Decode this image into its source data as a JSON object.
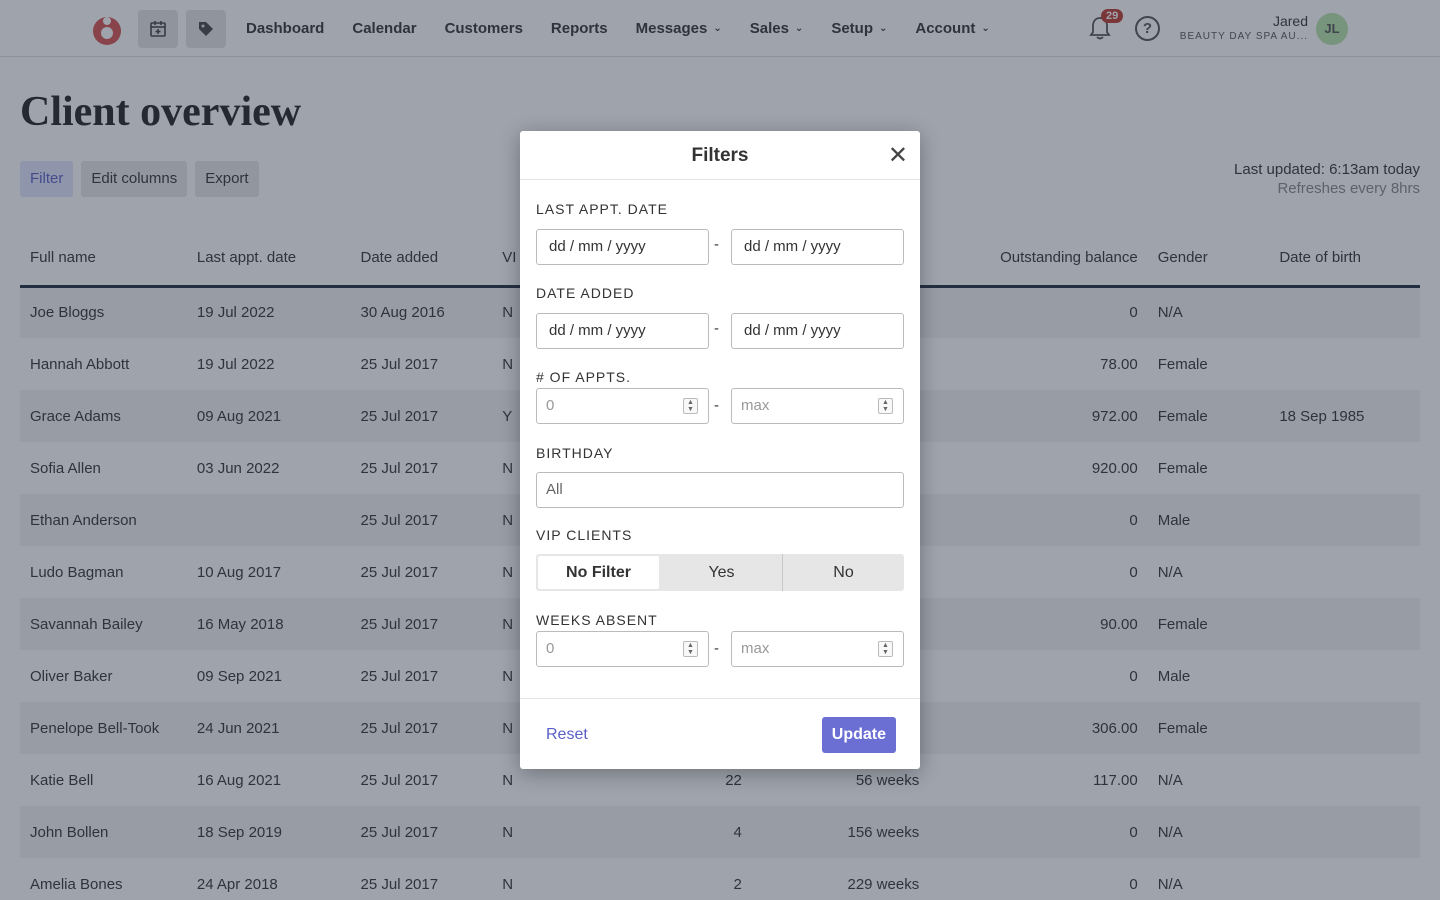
{
  "nav": {
    "links": [
      {
        "label": "Dashboard",
        "dropdown": false
      },
      {
        "label": "Calendar",
        "dropdown": false
      },
      {
        "label": "Customers",
        "dropdown": false
      },
      {
        "label": "Reports",
        "dropdown": false
      },
      {
        "label": "Messages",
        "dropdown": true
      },
      {
        "label": "Sales",
        "dropdown": true
      },
      {
        "label": "Setup",
        "dropdown": true
      },
      {
        "label": "Account",
        "dropdown": true
      }
    ],
    "notification_count": "29",
    "help_glyph": "?",
    "user_name": "Jared",
    "user_org": "BEAUTY DAY SPA AU...",
    "user_initials": "JL",
    "icons": [
      "calendar-plus-icon",
      "tag-icon",
      "bell-icon",
      "help-icon"
    ],
    "accent": "#d9534f"
  },
  "page": {
    "title": "Client overview",
    "toolbar": {
      "filter": "Filter",
      "edit_columns": "Edit columns",
      "export": "Export"
    },
    "last_updated": "Last updated: 6:13am today",
    "refreshes": "Refreshes every 8hrs"
  },
  "table": {
    "headers": {
      "full_name": "Full name",
      "last_appt": "Last appt. date",
      "date_added": "Date added",
      "vip": "VI",
      "balance": "Outstanding balance",
      "gender": "Gender",
      "dob": "Date of birth"
    },
    "rows": [
      {
        "name": "Joe Bloggs",
        "last": "19 Jul 2022",
        "added": "30 Aug 2016",
        "vip": "N",
        "appts": "",
        "absent": "",
        "balance": "0",
        "gender": "N/A",
        "dob": ""
      },
      {
        "name": "Hannah Abbott",
        "last": "19 Jul 2022",
        "added": "25 Jul 2017",
        "vip": "N",
        "appts": "",
        "absent": "",
        "balance": "78.00",
        "gender": "Female",
        "dob": ""
      },
      {
        "name": "Grace Adams",
        "last": "09 Aug 2021",
        "added": "25 Jul 2017",
        "vip": "Y",
        "appts": "",
        "absent": "",
        "balance": "972.00",
        "gender": "Female",
        "dob": "18 Sep 1985"
      },
      {
        "name": "Sofia Allen",
        "last": "03 Jun 2022",
        "added": "25 Jul 2017",
        "vip": "N",
        "appts": "",
        "absent": "",
        "balance": "920.00",
        "gender": "Female",
        "dob": ""
      },
      {
        "name": "Ethan Anderson",
        "last": "",
        "added": "25 Jul 2017",
        "vip": "N",
        "appts": "",
        "absent": "",
        "balance": "0",
        "gender": "Male",
        "dob": ""
      },
      {
        "name": "Ludo Bagman",
        "last": "10 Aug 2017",
        "added": "25 Jul 2017",
        "vip": "N",
        "appts": "",
        "absent": "",
        "balance": "0",
        "gender": "N/A",
        "dob": ""
      },
      {
        "name": "Savannah Bailey",
        "last": "16 May 2018",
        "added": "25 Jul 2017",
        "vip": "N",
        "appts": "",
        "absent": "",
        "balance": "90.00",
        "gender": "Female",
        "dob": ""
      },
      {
        "name": "Oliver Baker",
        "last": "09 Sep 2021",
        "added": "25 Jul 2017",
        "vip": "N",
        "appts": "",
        "absent": "",
        "balance": "0",
        "gender": "Male",
        "dob": ""
      },
      {
        "name": "Penelope Bell-Took",
        "last": "24 Jun 2021",
        "added": "25 Jul 2017",
        "vip": "N",
        "appts": "",
        "absent": "",
        "balance": "306.00",
        "gender": "Female",
        "dob": ""
      },
      {
        "name": "Katie Bell",
        "last": "16 Aug 2021",
        "added": "25 Jul 2017",
        "vip": "N",
        "appts": "22",
        "absent": "56 weeks",
        "balance": "117.00",
        "gender": "N/A",
        "dob": ""
      },
      {
        "name": "John Bollen",
        "last": "18 Sep 2019",
        "added": "25 Jul 2017",
        "vip": "N",
        "appts": "4",
        "absent": "156 weeks",
        "balance": "0",
        "gender": "N/A",
        "dob": ""
      },
      {
        "name": "Amelia Bones",
        "last": "24 Apr 2018",
        "added": "25 Jul 2017",
        "vip": "N",
        "appts": "2",
        "absent": "229 weeks",
        "balance": "0",
        "gender": "N/A",
        "dob": ""
      }
    ]
  },
  "modal": {
    "title": "Filters",
    "close_glyph": "✕",
    "last_appt_label": "LAST APPT. DATE",
    "date_added_label": "DATE ADDED",
    "appts_label": "# OF APPTS.",
    "birthday_label": "BIRTHDAY",
    "vip_label": "VIP CLIENTS",
    "weeks_absent_label": "WEEKS ABSENT",
    "date_placeholder": "dd / mm / yyyy",
    "min_placeholder": "0",
    "max_placeholder": "max",
    "birthday_value": "All",
    "range_separator": "-",
    "vip_options": [
      "No Filter",
      "Yes",
      "No"
    ],
    "vip_selected": "No Filter",
    "reset": "Reset",
    "update": "Update",
    "accent": "#6b6fd4"
  }
}
